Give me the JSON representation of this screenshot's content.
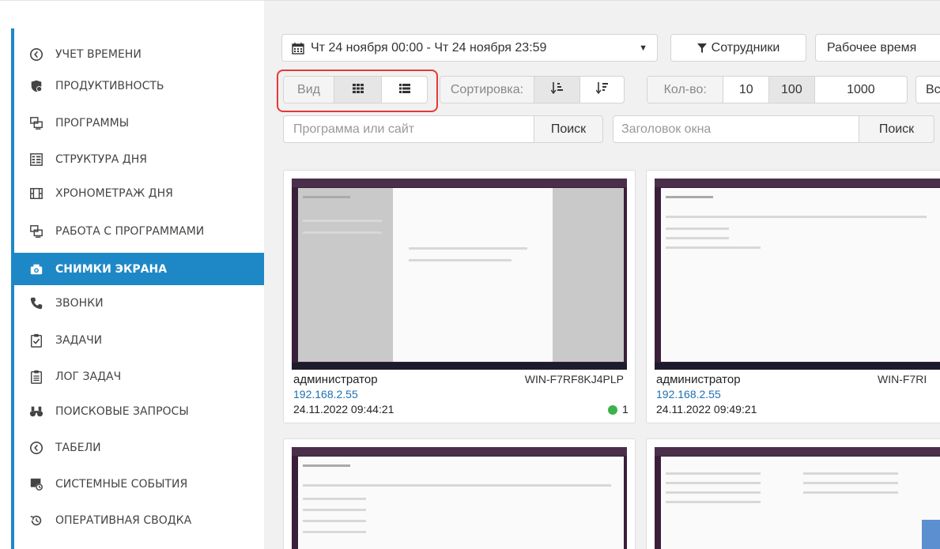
{
  "sidebar": {
    "items": [
      {
        "label": "УЧЕТ ВРЕМЕНИ",
        "icon": "clock-icon"
      },
      {
        "label": "ПРОДУКТИВНОСТЬ",
        "icon": "productivity-icon"
      },
      {
        "label": "ПРОГРАММЫ",
        "icon": "monitor-icon"
      },
      {
        "label": "СТРУКТУРА ДНЯ",
        "icon": "day-structure-icon"
      },
      {
        "label": "ХРОНОМЕТРАЖ ДНЯ",
        "icon": "film-icon"
      },
      {
        "label": "РАБОТА С ПРОГРАММАМИ",
        "icon": "monitor-icon"
      },
      {
        "label": "СНИМКИ ЭКРАНА",
        "icon": "camera-icon"
      },
      {
        "label": "ЗВОНКИ",
        "icon": "phone-icon"
      },
      {
        "label": "ЗАДАЧИ",
        "icon": "clipboard-check-icon"
      },
      {
        "label": "ЛОГ ЗАДАЧ",
        "icon": "clipboard-list-icon"
      },
      {
        "label": "ПОИСКОВЫЕ ЗАПРОСЫ",
        "icon": "binoculars-icon"
      },
      {
        "label": "ТАБЕЛИ",
        "icon": "clock-icon"
      },
      {
        "label": "СИСТЕМНЫЕ СОБЫТИЯ",
        "icon": "system-events-icon"
      },
      {
        "label": "ОПЕРАТИВНАЯ СВОДКА",
        "icon": "history-icon"
      }
    ],
    "active_label": "СНИМКИ ЭКРАНА",
    "accent_color": "#1e88c7"
  },
  "toolbar": {
    "date_range": "Чт 24 ноября 00:00 - Чт 24 ноября 23:59",
    "employees_label": "Сотрудники",
    "worktime_label": "Рабочее время",
    "view_label": "Вид",
    "sort_label": "Сортировка:",
    "count_label": "Кол-во:",
    "count_options": [
      "10",
      "100",
      "1000"
    ],
    "count_selected": "100",
    "all_label": "Вс"
  },
  "search": {
    "program_placeholder": "Программа или сайт",
    "program_button": "Поиск",
    "title_placeholder": "Заголовок окна",
    "title_button": "Поиск"
  },
  "screenshots": [
    {
      "user": "администратор",
      "ip": "192.168.2.55",
      "datetime": "24.11.2022 09:44:21",
      "host": "WIN-F7RF8KJ4PLP",
      "count": "1"
    },
    {
      "user": "администратор",
      "ip": "192.168.2.55",
      "datetime": "24.11.2022 09:49:21",
      "host": "WIN-F7RI"
    }
  ],
  "highlight_color": "#e53935"
}
